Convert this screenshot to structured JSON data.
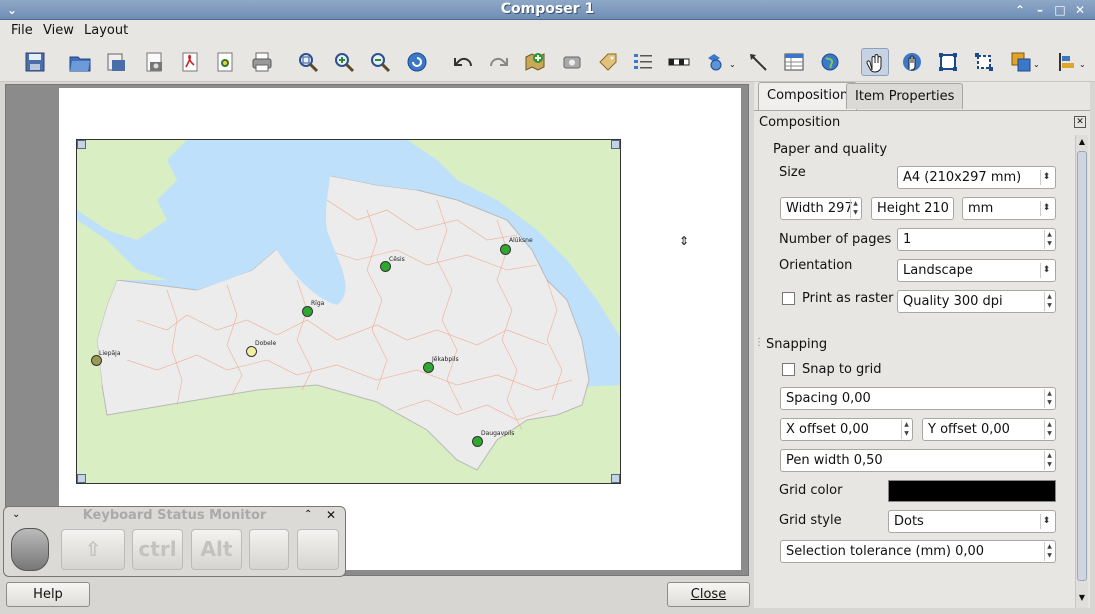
{
  "window": {
    "title": "Composer 1"
  },
  "menu": [
    "File",
    "View",
    "Layout"
  ],
  "toolbar_icons": [
    "save-icon",
    "open-template-icon",
    "save-template-icon",
    "export-image-icon",
    "export-pdf-icon",
    "export-svg-icon",
    "print-icon",
    "zoom-full-icon",
    "zoom-in-icon",
    "zoom-out-icon",
    "refresh-icon",
    "undo-icon",
    "redo-icon",
    "add-map-icon",
    "add-image-icon",
    "add-label-icon",
    "add-legend-icon",
    "add-scalebar-icon",
    "add-shape-icon",
    "add-arrow-icon",
    "add-table-icon",
    "add-html-icon",
    "select-move-icon",
    "move-content-icon",
    "group-icon",
    "ungroup-icon",
    "raise-items-icon",
    "align-items-icon"
  ],
  "map": {
    "cities": [
      {
        "name": "Alūksne",
        "color": "#2ea82e"
      },
      {
        "name": "Cēsis",
        "color": "#2ea82e"
      },
      {
        "name": "Rīga",
        "color": "#2ea82e"
      },
      {
        "name": "Liepāja",
        "color": "#9a9a55"
      },
      {
        "name": "Dobele",
        "color": "#f3efa0"
      },
      {
        "name": "Jēkabpils",
        "color": "#2ea82e"
      },
      {
        "name": "Daugavpils",
        "color": "#2ea82e"
      }
    ]
  },
  "tabs": {
    "composition": "Composition",
    "item_properties": "Item Properties"
  },
  "composition": {
    "header": "Composition",
    "paper_section": "Paper and quality",
    "size_label": "Size",
    "size_value": "A4 (210x297 mm)",
    "width_value": "Width 297",
    "height_value": "Height 210",
    "unit_value": "mm",
    "pages_label": "Number of pages",
    "pages_value": "1",
    "orientation_label": "Orientation",
    "orientation_value": "Landscape",
    "raster_label": "Print as raster",
    "quality_value": "Quality 300 dpi",
    "snapping_section": "Snapping",
    "snap_label": "Snap to grid",
    "spacing_value": "Spacing 0,00",
    "xoffset_value": "X offset 0,00",
    "yoffset_value": "Y offset 0,00",
    "penwidth_value": "Pen width 0,50",
    "gridcolor_label": "Grid color",
    "gridcolor": "#000000",
    "gridstyle_label": "Grid style",
    "gridstyle_value": "Dots",
    "tolerance_value": "Selection tolerance (mm) 0,00"
  },
  "buttons": {
    "help": "Help",
    "close": "Close"
  },
  "ksm": {
    "title": "Keyboard Status Monitor",
    "keys": [
      "",
      "ctrl",
      "Alt",
      "",
      ""
    ]
  }
}
